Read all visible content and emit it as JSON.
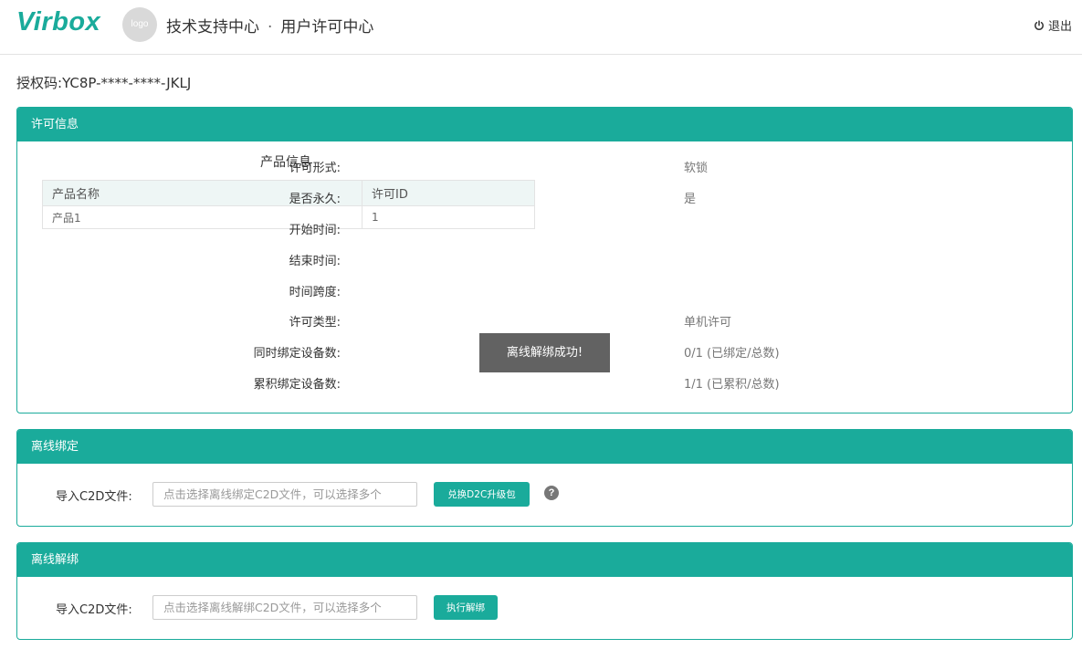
{
  "header": {
    "brand": "Virbox",
    "logo_text": "logo",
    "title_left": "技术支持中心",
    "separator": "·",
    "title_right": "用户许可中心",
    "logout_label": "退出",
    "logout_icon": "power-icon"
  },
  "auth": {
    "label": "授权码:",
    "value": "YC8P-****-****-JKLJ"
  },
  "license_panel": {
    "title": "许可信息",
    "product_section_title": "产品信息",
    "table": {
      "columns": [
        "产品名称",
        "许可ID"
      ],
      "rows": [
        [
          "产品1",
          "1"
        ]
      ]
    },
    "info": [
      {
        "label": "许可形式:",
        "value": "软锁"
      },
      {
        "label": "是否永久:",
        "value": "是"
      },
      {
        "label": "开始时间:",
        "value": ""
      },
      {
        "label": "结束时间:",
        "value": ""
      },
      {
        "label": "时间跨度:",
        "value": ""
      },
      {
        "label": "许可类型:",
        "value": "单机许可"
      },
      {
        "label": "同时绑定设备数:",
        "value": "0/1 (已绑定/总数)"
      },
      {
        "label": "累积绑定设备数:",
        "value": "1/1 (已累积/总数)"
      }
    ]
  },
  "toast": {
    "message": "离线解绑成功!"
  },
  "offline_bind": {
    "title": "离线绑定",
    "label": "导入C2D文件:",
    "placeholder": "点击选择离线绑定C2D文件，可以选择多个",
    "button": "兑换D2C升级包",
    "help_icon": "question-circle-icon"
  },
  "offline_unbind": {
    "title": "离线解绑",
    "label": "导入C2D文件:",
    "placeholder": "点击选择离线解绑C2D文件，可以选择多个",
    "button": "执行解绑"
  },
  "colors": {
    "accent": "#1aab9b",
    "toast_bg": "#555555"
  }
}
